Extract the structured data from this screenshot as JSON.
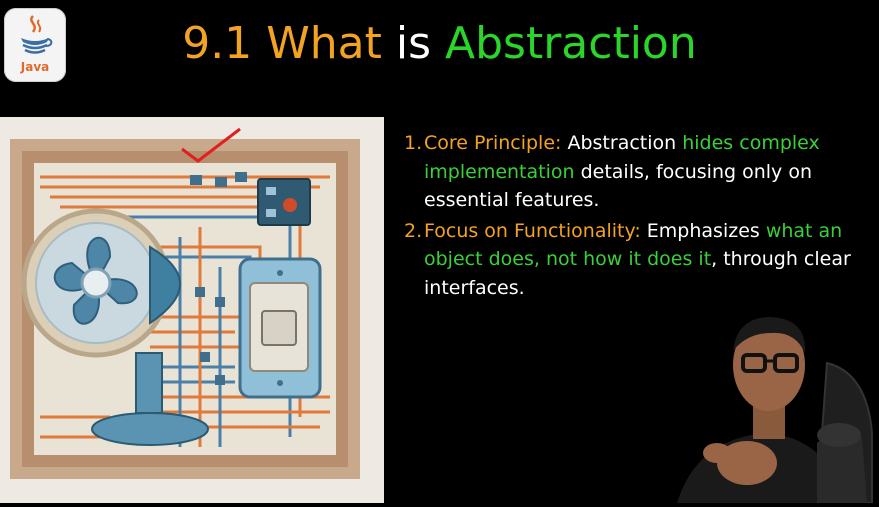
{
  "logo": {
    "text": "Java",
    "icon": "java-coffee-cup-icon"
  },
  "title": {
    "num": "9.1",
    "what": "What",
    "is": "is",
    "abstraction": "Abstraction"
  },
  "points": [
    {
      "num": "1.",
      "label": "Core Principle:",
      "t1": " Abstraction ",
      "h1": "hides complex implementation",
      "t2": " details, focusing only on essential features."
    },
    {
      "num": "2.",
      "label": "Focus on Functionality:",
      "t1": " Emphasizes ",
      "h1": "what an object does, not how it does it",
      "t2": ", through clear interfaces."
    }
  ],
  "colors": {
    "background": "#000000",
    "orange": "#f3a322",
    "green": "#2ad62a",
    "highlight_green": "#39d039",
    "white": "#ffffff"
  },
  "illustration": {
    "subject": "fan-wired-to-switch-illustration"
  },
  "presenter": {
    "subject": "presenter-webcam"
  }
}
